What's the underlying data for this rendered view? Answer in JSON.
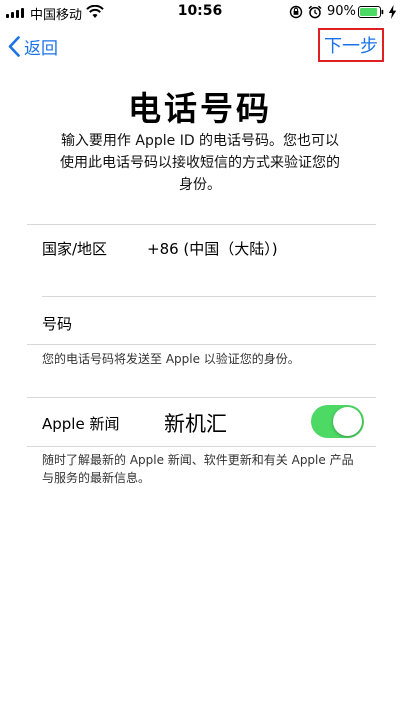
{
  "status_bar": {
    "carrier": "中国移动",
    "time": "10:56",
    "battery_percent": "90%",
    "battery_level": 0.9,
    "icons": [
      "signal-icon",
      "wifi-icon",
      "orientation-lock-icon",
      "alarm-icon",
      "battery-icon",
      "charging-icon"
    ]
  },
  "nav": {
    "back_label": "返回",
    "next_label": "下一步"
  },
  "header": {
    "title": "电话号码",
    "description": "输入要用作 Apple ID 的电话号码。您也可以使用此电话号码以接收短信的方式来验证您的身份。"
  },
  "form": {
    "country_label": "国家/地区",
    "country_value": "+86 (中国（大陆）)",
    "number_label": "号码",
    "number_value": "",
    "number_note": "您的电话号码将发送至 Apple 以验证您的身份。"
  },
  "news": {
    "label": "Apple 新闻",
    "watermark": "新机汇",
    "toggle_on": true,
    "note": "随时了解最新的 Apple 新闻、软件更新和有关 Apple 产品与服务的最新信息。"
  },
  "colors": {
    "accent": "#1a73e8",
    "toggle_on": "#4cd964",
    "highlight_border": "#e02020",
    "separator": "#d8d8d8"
  }
}
